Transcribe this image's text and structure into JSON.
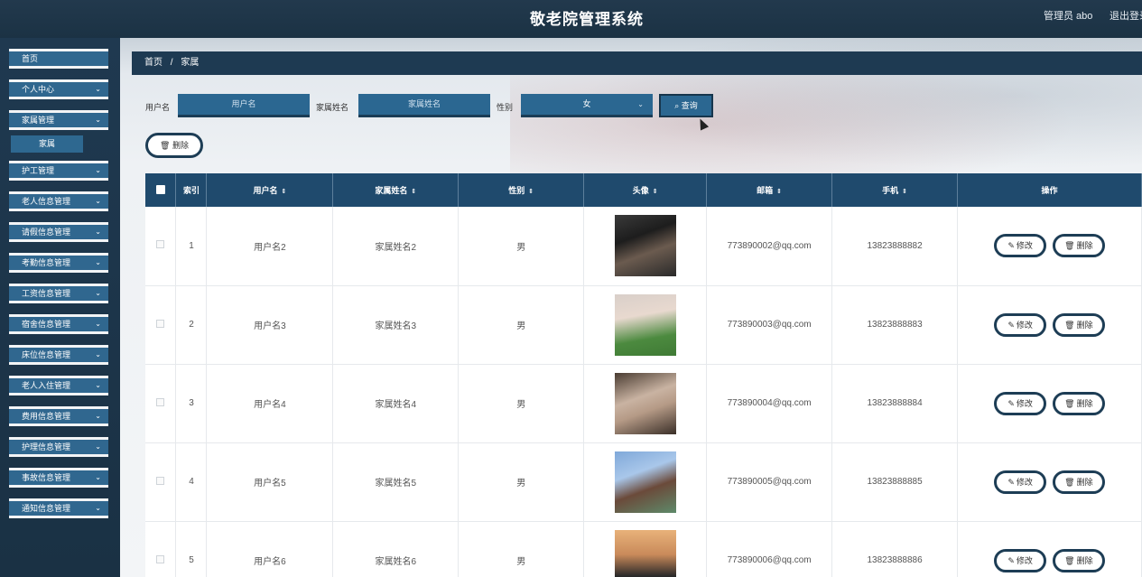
{
  "header": {
    "title": "敬老院管理系统",
    "user": "管理员 abo",
    "logout": "退出登录"
  },
  "sidebar": {
    "items": [
      {
        "label": "首页",
        "chevron": false
      },
      {
        "label": "个人中心",
        "chevron": true
      },
      {
        "label": "家属管理",
        "chevron": true
      },
      {
        "label": "护工管理",
        "chevron": true
      },
      {
        "label": "老人信息管理",
        "chevron": true
      },
      {
        "label": "请假信息管理",
        "chevron": true
      },
      {
        "label": "考勤信息管理",
        "chevron": true
      },
      {
        "label": "工资信息管理",
        "chevron": true
      },
      {
        "label": "宿舍信息管理",
        "chevron": true
      },
      {
        "label": "床位信息管理",
        "chevron": true
      },
      {
        "label": "老人入住管理",
        "chevron": true
      },
      {
        "label": "费用信息管理",
        "chevron": true
      },
      {
        "label": "护理信息管理",
        "chevron": true
      },
      {
        "label": "事故信息管理",
        "chevron": true
      },
      {
        "label": "通知信息管理",
        "chevron": true
      }
    ],
    "subitem": "家属"
  },
  "breadcrumb": {
    "home": "首页",
    "sep": "/",
    "current": "家属"
  },
  "search": {
    "username_label": "用户名",
    "username_placeholder": "用户名",
    "family_label": "家属姓名",
    "family_placeholder": "家属姓名",
    "gender_label": "性别",
    "gender_value": "女",
    "query_button": "查询"
  },
  "delete_button": "删除",
  "table": {
    "headers": [
      "索引",
      "用户名",
      "家属姓名",
      "性别",
      "头像",
      "邮箱",
      "手机",
      "操作"
    ],
    "rows": [
      {
        "index": "1",
        "username": "用户名2",
        "name": "家属姓名2",
        "gender": "男",
        "email": "773890002@qq.com",
        "phone": "13823888882"
      },
      {
        "index": "2",
        "username": "用户名3",
        "name": "家属姓名3",
        "gender": "男",
        "email": "773890003@qq.com",
        "phone": "13823888883"
      },
      {
        "index": "3",
        "username": "用户名4",
        "name": "家属姓名4",
        "gender": "男",
        "email": "773890004@qq.com",
        "phone": "13823888884"
      },
      {
        "index": "4",
        "username": "用户名5",
        "name": "家属姓名5",
        "gender": "男",
        "email": "773890005@qq.com",
        "phone": "13823888885"
      },
      {
        "index": "5",
        "username": "用户名6",
        "name": "家属姓名6",
        "gender": "男",
        "email": "773890006@qq.com",
        "phone": "13823888886"
      }
    ],
    "edit_label": "修改",
    "delete_label": "删除"
  },
  "colors": {
    "sidebar_item": "#30678f",
    "table_header": "#1f4a6d",
    "topbar": "#1e3447"
  }
}
